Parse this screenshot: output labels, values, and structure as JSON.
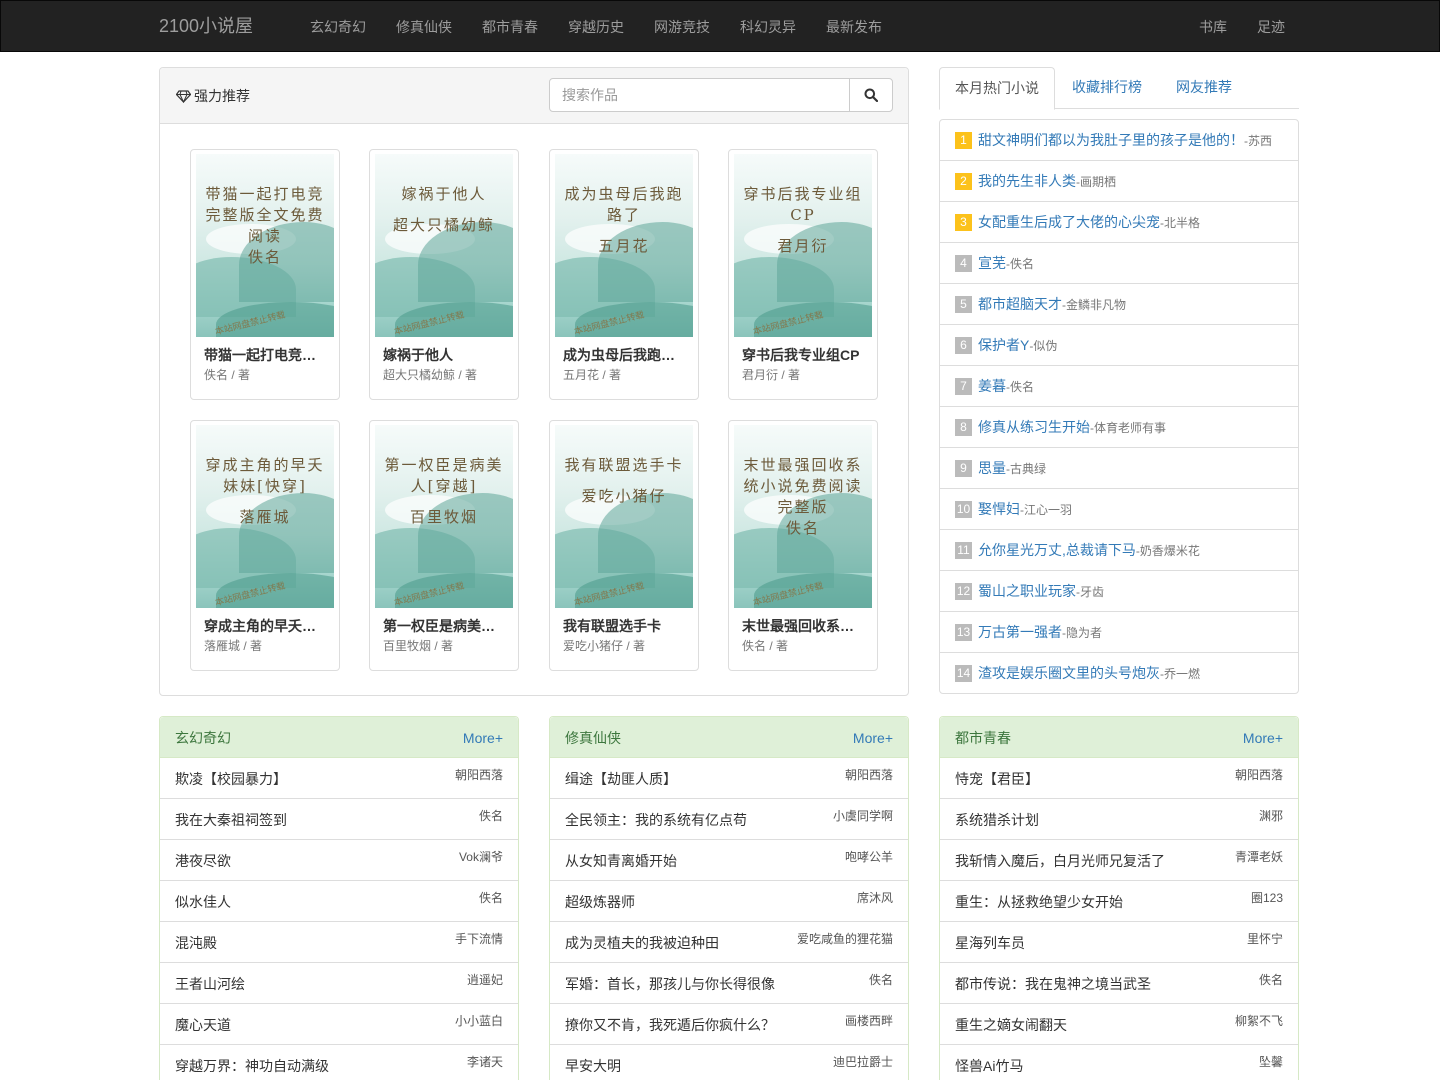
{
  "navbar": {
    "brand": "2100小说屋",
    "menu": [
      "玄幻奇幻",
      "修真仙侠",
      "都市青春",
      "穿越历史",
      "网游竞技",
      "科幻灵异",
      "最新发布"
    ],
    "right": [
      "书库",
      "足迹"
    ]
  },
  "recommend": {
    "title": "强力推荐",
    "search_placeholder": "搜索作品",
    "books": [
      {
        "cover_text": "带猫一起打电竞完整版全文免费阅读佚名",
        "title": "带猫一起打电竞完整版全文免费阅读",
        "author": "佚名 / 著"
      },
      {
        "cover_text": "嫁祸于他人 超大只橘幼鲸",
        "title": "嫁祸于他人",
        "author": "超大只橘幼鲸 / 著"
      },
      {
        "cover_text": "成为虫母后我跑路了 五月花",
        "title": "成为虫母后我跑路了",
        "author": "五月花 / 著"
      },
      {
        "cover_text": "穿书后我专业组CP 君月衍",
        "title": "穿书后我专业组CP",
        "author": "君月衍 / 著"
      },
      {
        "cover_text": "穿成主角的早夭妹妹[快穿] 落雁城",
        "title": "穿成主角的早夭妹妹[快穿]",
        "author": "落雁城 / 著"
      },
      {
        "cover_text": "第一权臣是病美人[穿越] 百里牧烟",
        "title": "第一权臣是病美人[穿越]",
        "author": "百里牧烟 / 著"
      },
      {
        "cover_text": "我有联盟选手卡 爱吃小猪仔",
        "title": "我有联盟选手卡",
        "author": "爱吃小猪仔 / 著"
      },
      {
        "cover_text": "末世最强回收系统小说免费阅读完整版佚名",
        "title": "末世最强回收系统小说免费阅读完整版",
        "author": "佚名 / 著"
      }
    ],
    "cover_lines": [
      [
        "带猫一起打电竞",
        "完整版全文免费",
        "阅读",
        "佚名"
      ],
      [
        "嫁祸于他人",
        "",
        "超大只橘幼鲸"
      ],
      [
        "成为虫母后我跑",
        "路了",
        "",
        "五月花"
      ],
      [
        "穿书后我专业组",
        "CP",
        "",
        "君月衍"
      ],
      [
        "穿成主角的早夭",
        "妹妹[快穿]",
        "",
        "落雁城"
      ],
      [
        "第一权臣是病美",
        "人[穿越]",
        "",
        "百里牧烟"
      ],
      [
        "我有联盟选手卡",
        "",
        "爱吃小猪仔"
      ],
      [
        "末世最强回收系",
        "统小说免费阅读",
        "完整版",
        "佚名"
      ]
    ],
    "watermark": "本站网盘禁止转载"
  },
  "tabs": [
    "本月热门小说",
    "收藏排行榜",
    "网友推荐"
  ],
  "hot": [
    {
      "rank": "1",
      "title": "甜文神明们都以为我肚子里的孩子是他的！",
      "author": "-苏西"
    },
    {
      "rank": "2",
      "title": "我的先生非人类",
      "author": "-画期栖"
    },
    {
      "rank": "3",
      "title": "女配重生后成了大佬的心尖宠",
      "author": "-北半格"
    },
    {
      "rank": "4",
      "title": "宣芜",
      "author": "-佚名"
    },
    {
      "rank": "5",
      "title": "都市超脑天才",
      "author": "-金鳞非凡物"
    },
    {
      "rank": "6",
      "title": "保护者Y",
      "author": "-似伪"
    },
    {
      "rank": "7",
      "title": "姜暮",
      "author": "-佚名"
    },
    {
      "rank": "8",
      "title": "修真从练习生开始",
      "author": "-体育老师有事"
    },
    {
      "rank": "9",
      "title": "思量",
      "author": "-古典绿"
    },
    {
      "rank": "10",
      "title": "娶悍妇",
      "author": "-江心一羽"
    },
    {
      "rank": "11",
      "title": "允你星光万丈,总裁请下马",
      "author": "-奶香爆米花"
    },
    {
      "rank": "12",
      "title": "蜀山之职业玩家",
      "author": "-牙齿"
    },
    {
      "rank": "13",
      "title": "万古第一强者",
      "author": "-隐为者"
    },
    {
      "rank": "14",
      "title": "渣攻是娱乐圈文里的头号炮灰",
      "author": "-乔一燃"
    }
  ],
  "categories": [
    {
      "title": "玄幻奇幻",
      "more": "More+",
      "rows": [
        {
          "t": "欺凌【校园暴力】",
          "a": "朝阳西落"
        },
        {
          "t": "我在大秦祖祠签到",
          "a": "佚名"
        },
        {
          "t": "港夜尽欲",
          "a": "Vok澜爷"
        },
        {
          "t": "似水佳人",
          "a": "佚名"
        },
        {
          "t": "混沌殿",
          "a": "手下流情"
        },
        {
          "t": "王者山河绘",
          "a": "逍遥妃"
        },
        {
          "t": "魔心天道",
          "a": "小小蓝白"
        },
        {
          "t": "穿越万界：神功自动满级",
          "a": "李诸天"
        }
      ]
    },
    {
      "title": "修真仙侠",
      "more": "More+",
      "rows": [
        {
          "t": "缉途【劫匪人质】",
          "a": "朝阳西落"
        },
        {
          "t": "全民领主：我的系统有亿点苟",
          "a": "小虞同学啊"
        },
        {
          "t": "从女知青离婚开始",
          "a": "咆哮公羊"
        },
        {
          "t": "超级炼器师",
          "a": "席沐风"
        },
        {
          "t": "成为灵植夫的我被迫种田",
          "a": "爱吃咸鱼的狸花猫"
        },
        {
          "t": "军婚：首长，那孩儿与你长得很像",
          "a": "佚名"
        },
        {
          "t": "撩你又不肯，我死遁后你疯什么？",
          "a": "画楼西畔"
        },
        {
          "t": "早安大明",
          "a": "迪巴拉爵士"
        }
      ]
    },
    {
      "title": "都市青春",
      "more": "More+",
      "rows": [
        {
          "t": "恃宠【君臣】",
          "a": "朝阳西落"
        },
        {
          "t": "系统猎杀计划",
          "a": "渊邪"
        },
        {
          "t": "我斩情入魔后，白月光师兄复活了",
          "a": "青潭老妖"
        },
        {
          "t": "重生：从拯救绝望少女开始",
          "a": "圈123"
        },
        {
          "t": "星海列车员",
          "a": "里怀宁"
        },
        {
          "t": "都市传说：我在鬼神之境当武圣",
          "a": "佚名"
        },
        {
          "t": "重生之嫡女闹翻天",
          "a": "柳絮不飞"
        },
        {
          "t": "怪兽Ai竹马",
          "a": "坠馨"
        }
      ]
    }
  ]
}
